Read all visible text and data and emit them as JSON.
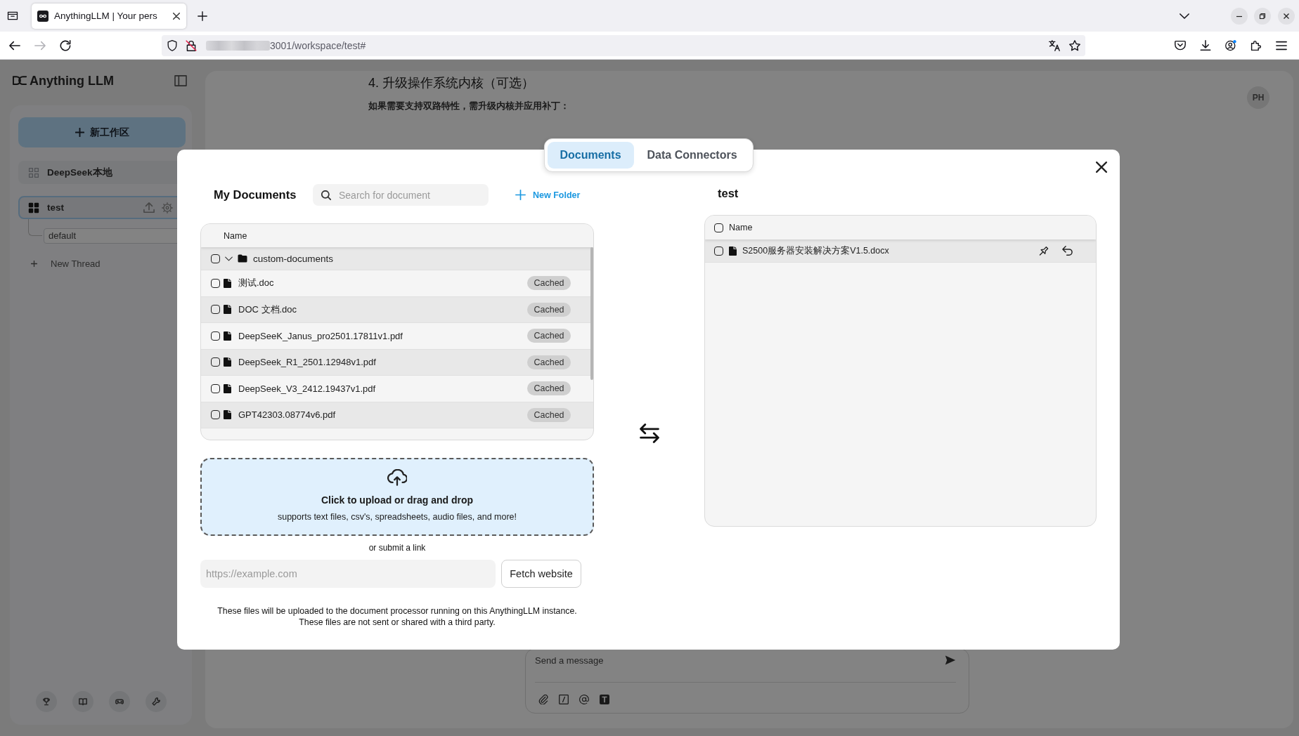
{
  "browser": {
    "tab": {
      "title": "AnythingLLM | Your pers",
      "selected": true
    },
    "forward": {
      "disabled": true
    },
    "address": "3001/workspace/test#"
  },
  "sidebar": {
    "logo": "Anything LLM",
    "new_workspace": "新工作区",
    "workspaces": [
      {
        "name": "DeepSeek本地",
        "selected": false
      },
      {
        "name": "test",
        "selected": true,
        "threads": [
          {
            "name": "default",
            "selected": true
          }
        ]
      }
    ],
    "new_thread": "New Thread"
  },
  "chat": {
    "heading": "4. 升级操作系统内核（可选）",
    "paragraph": "如果需要支持双路特性，需升级内核并应用补丁：",
    "avatar": "PH",
    "message_placeholder": "Send a message"
  },
  "modal": {
    "tabs": [
      {
        "label": "Documents",
        "selected": true
      },
      {
        "label": "Data Connectors",
        "selected": false
      }
    ],
    "documents": {
      "title": "My Documents",
      "search_placeholder": "Search for document",
      "new_folder": "New Folder",
      "column": "Name",
      "folders": [
        {
          "name": "custom-documents",
          "checked": false,
          "expanded": true,
          "files": [
            {
              "name": "测试.doc",
              "status": "Cached",
              "checked": false
            },
            {
              "name": "DOC 文档.doc",
              "status": "Cached",
              "checked": false
            },
            {
              "name": "DeepSeeK_Janus_pro2501.17811v1.pdf",
              "status": "Cached",
              "checked": false
            },
            {
              "name": "DeepSeek_R1_2501.12948v1.pdf",
              "status": "Cached",
              "checked": false
            },
            {
              "name": "DeepSeek_V3_2412.19437v1.pdf",
              "status": "Cached",
              "checked": false
            },
            {
              "name": "GPT42303.08774v6.pdf",
              "status": "Cached",
              "checked": false
            }
          ]
        }
      ]
    },
    "upload": {
      "title": "Click to upload or drag and drop",
      "subtitle": "supports text files, csv's, spreadsheets, audio files, and more!"
    },
    "link": {
      "label": "or submit a link",
      "placeholder": "https://example.com",
      "button": "Fetch website"
    },
    "notice": "These files will be uploaded to the document processor running on this AnythingLLM instance.\nThese files are not sent or shared with a third party.",
    "workspace": {
      "title": "test",
      "column": "Name",
      "all_checked": false,
      "files": [
        {
          "name": "S2500服务器安装解决方案V1.5.docx",
          "checked": false,
          "pinned": false
        }
      ]
    }
  }
}
